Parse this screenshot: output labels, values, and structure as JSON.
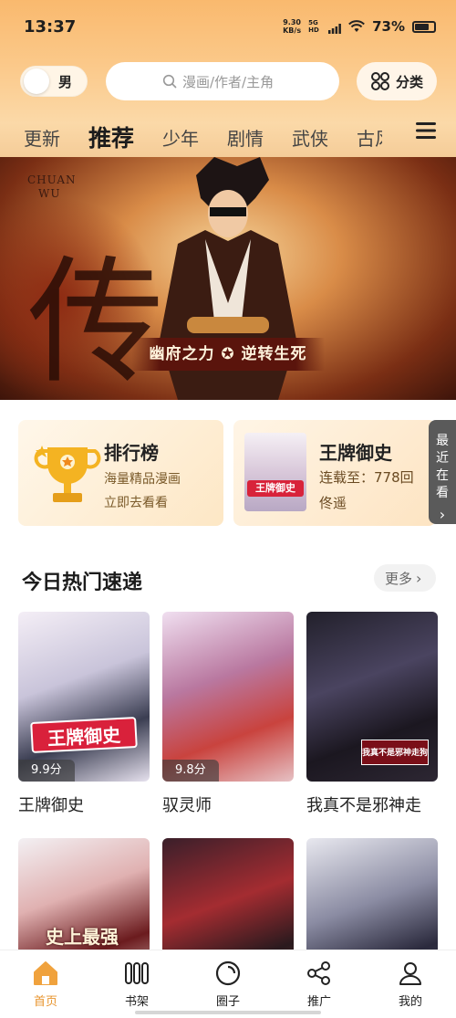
{
  "status_bar": {
    "time": "13:37",
    "net_speed_value": "9.30",
    "net_speed_unit": "KB/s",
    "network": "5G HD",
    "battery": "73%"
  },
  "header": {
    "gender_label": "男",
    "search_placeholder": "漫画/作者/主角",
    "classify_label": "分类"
  },
  "tabs": [
    {
      "label": "更新",
      "active": false
    },
    {
      "label": "推荐",
      "active": true
    },
    {
      "label": "少年",
      "active": false
    },
    {
      "label": "剧情",
      "active": false
    },
    {
      "label": "武侠",
      "active": false
    },
    {
      "label": "古风",
      "active": false
    }
  ],
  "banner": {
    "brand_line1": "CHUAN",
    "brand_line2": "WU",
    "big_title": "传武",
    "caption": "幽府之力 ✪ 逆转生死"
  },
  "cards": {
    "rank": {
      "title": "排行榜",
      "subtitle": "海量精品漫画",
      "action": "立即去看看"
    },
    "recent": {
      "title": "王牌御史",
      "progress": "连载至：778回",
      "author": "佟遥",
      "cover_text": "王牌御史"
    },
    "recent_tab_label": [
      "最",
      "近",
      "在",
      "看"
    ]
  },
  "section": {
    "title": "今日热门速递",
    "more_label": "更多"
  },
  "comics": [
    {
      "title": "王牌御史",
      "score": "9.9分",
      "cover_text": "王牌御史"
    },
    {
      "title": "驭灵师",
      "score": "9.8分",
      "cover_text": ""
    },
    {
      "title": "我真不是邪神走",
      "score": "",
      "cover_text": "我真不是邪神走狗"
    },
    {
      "title": "",
      "score": "",
      "cover_text": "史上最强"
    },
    {
      "title": "",
      "score": "",
      "cover_text": ""
    },
    {
      "title": "",
      "score": "",
      "cover_text": ""
    }
  ],
  "bottom_nav": [
    {
      "label": "首页",
      "icon": "home-icon",
      "active": true
    },
    {
      "label": "书架",
      "icon": "bookshelf-icon",
      "active": false
    },
    {
      "label": "圈子",
      "icon": "circle-icon",
      "active": false
    },
    {
      "label": "推广",
      "icon": "share-icon",
      "active": false
    },
    {
      "label": "我的",
      "icon": "profile-icon",
      "active": false
    }
  ],
  "colors": {
    "accent": "#e8952f",
    "header_gradient_top": "#f9b96e",
    "score_badge": "#3c3c3c"
  }
}
